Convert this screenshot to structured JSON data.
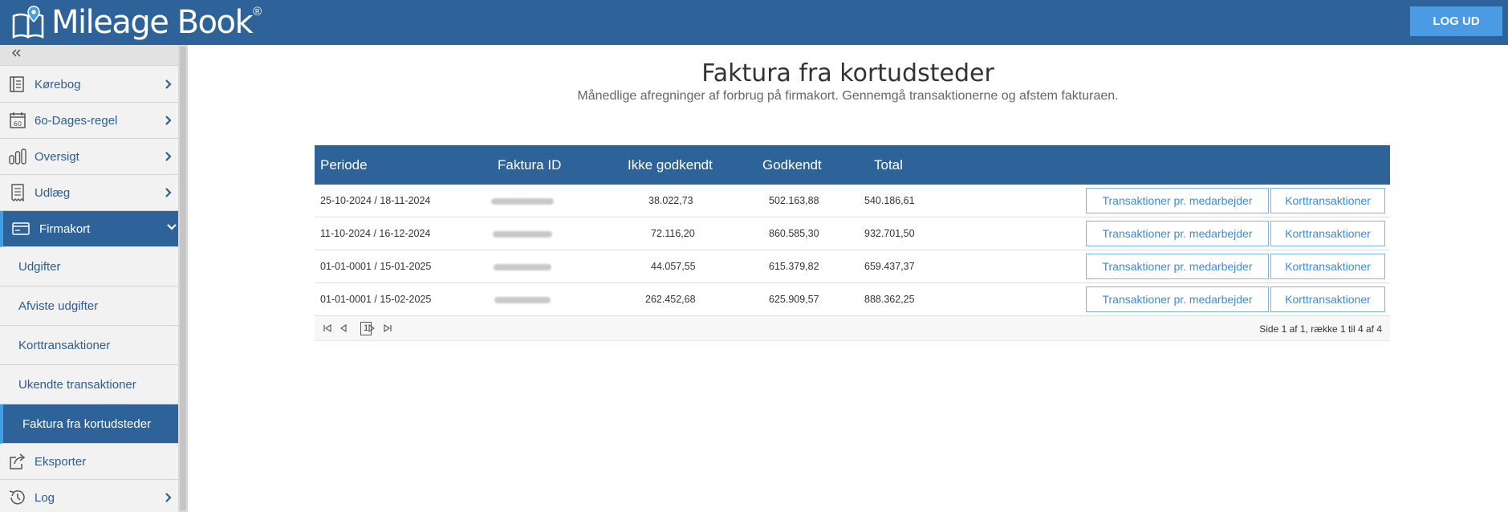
{
  "app": {
    "logo_text": "Mileage Book",
    "logo_mark": "®",
    "logout_label": "LOG UD",
    "brand_color": "#2e6399",
    "accent_color": "#4a9ae4"
  },
  "sidebar": {
    "collapse_icon": "double-chevron-left-icon",
    "items": [
      {
        "label": "Kørebog",
        "icon": "logbook-icon",
        "has_chevron": true
      },
      {
        "label": "6o-Dages-regel",
        "icon": "calendar-60-icon",
        "has_chevron": true
      },
      {
        "label": "Oversigt",
        "icon": "bar-chart-icon",
        "has_chevron": true
      },
      {
        "label": "Udlæg",
        "icon": "receipt-icon",
        "has_chevron": true
      },
      {
        "label": "Firmakort",
        "icon": "credit-card-icon",
        "has_chevron": true,
        "expanded": true
      }
    ],
    "subitems": [
      {
        "label": "Udgifter"
      },
      {
        "label": "Afviste udgifter"
      },
      {
        "label": "Korttransaktioner"
      },
      {
        "label": "Ukendte transaktioner"
      },
      {
        "label": "Faktura fra kortudsteder",
        "active": true
      }
    ],
    "bottom_items": [
      {
        "label": "Eksporter",
        "icon": "export-icon",
        "has_chevron": false
      },
      {
        "label": "Log",
        "icon": "history-icon",
        "has_chevron": true
      }
    ]
  },
  "main": {
    "title": "Faktura fra kortudsteder",
    "subtitle": "Månedlige afregninger af forbrug på firmakort. Gennemgå transaktionerne og afstem fakturaen."
  },
  "table": {
    "headers": [
      "Periode",
      "Faktura ID",
      "Ikke godkendt",
      "Godkendt",
      "Total"
    ],
    "rows": [
      {
        "periode": "25-10-2024 / 18-11-2024",
        "faktura_id_redacted": true,
        "ikke_godkendt": "38.022,73",
        "godkendt": "502.163,88",
        "total": "540.186,61"
      },
      {
        "periode": "11-10-2024 / 16-12-2024",
        "faktura_id_redacted": true,
        "ikke_godkendt": "72.116,20",
        "godkendt": "860.585,30",
        "total": "932.701,50"
      },
      {
        "periode": "01-01-0001 / 15-01-2025",
        "faktura_id_redacted": true,
        "ikke_godkendt": "44.057,55",
        "godkendt": "615.379,82",
        "total": "659.437,37"
      },
      {
        "periode": "01-01-0001 / 15-02-2025",
        "faktura_id_redacted": true,
        "ikke_godkendt": "262.452,68",
        "godkendt": "625.909,57",
        "total": "888.362,25"
      }
    ],
    "row_actions": [
      "Transaktioner pr. medarbejder",
      "Korttransaktioner"
    ],
    "pager": {
      "current_page": "1",
      "info": "Side 1 af 1, række 1 til 4 af 4",
      "icons": [
        "first-page-icon",
        "prev-page-icon",
        "next-page-icon",
        "last-page-icon"
      ]
    }
  }
}
